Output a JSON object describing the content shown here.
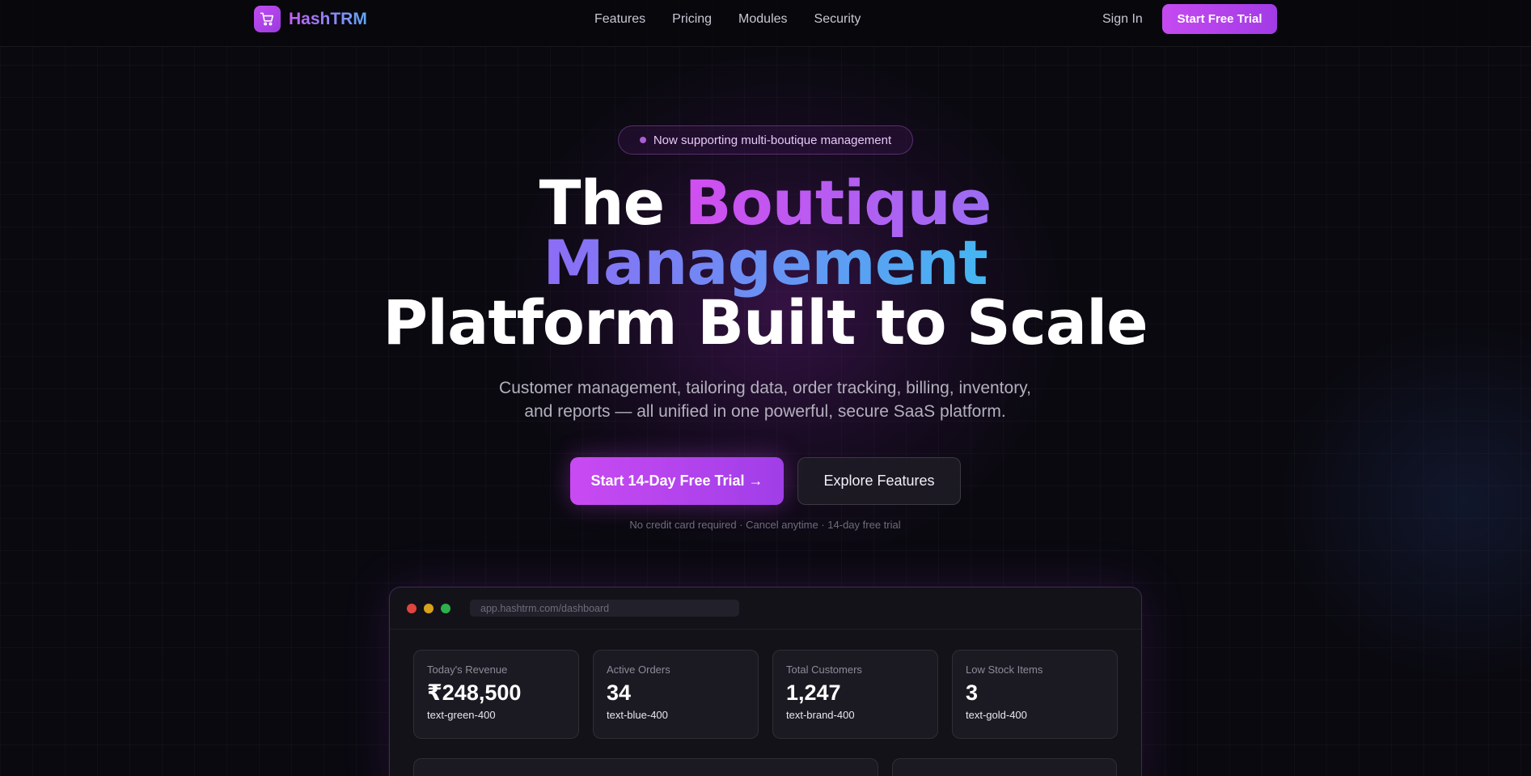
{
  "brand": {
    "name": "HashTRM",
    "icon": "shopping-cart-icon"
  },
  "nav": {
    "links": [
      "Features",
      "Pricing",
      "Modules",
      "Security"
    ],
    "sign_in": "Sign In",
    "cta": "Start Free Trial"
  },
  "hero": {
    "badge": "Now supporting multi-boutique management",
    "headline": {
      "part1": "The ",
      "part2": "Boutique",
      "part3": "Management",
      "part4": "Platform Built to Scale"
    },
    "subhead_line1": "Customer management, tailoring data, order tracking, billing, inventory,",
    "subhead_line2": "and reports — all unified in one powerful, secure SaaS platform.",
    "cta_primary": "Start 14-Day Free Trial →",
    "cta_secondary": "Explore Features",
    "fineprint": "No credit card required · Cancel anytime · 14-day free trial"
  },
  "preview": {
    "url": "app.hashtrm.com/dashboard",
    "stats": [
      {
        "label": "Today's Revenue",
        "value": "₹248,500",
        "class": "text-green-400"
      },
      {
        "label": "Active Orders",
        "value": "34",
        "class": "text-blue-400"
      },
      {
        "label": "Total Customers",
        "value": "1,247",
        "class": "text-brand-400"
      },
      {
        "label": "Low Stock Items",
        "value": "3",
        "class": "text-gold-400"
      }
    ]
  },
  "colors": {
    "background": "#0a0910",
    "accent_purple": "#c54af0",
    "accent_blue": "#45b6f2"
  }
}
